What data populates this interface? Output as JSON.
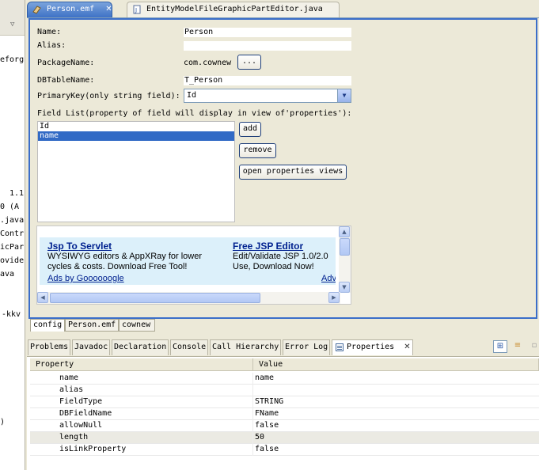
{
  "left_panel": {
    "fragments": [
      "eforg",
      "1.1",
      "0  (A",
      ".java",
      "Contr",
      "icPar",
      "ovide",
      "ava",
      "-kkv",
      ")"
    ]
  },
  "editor": {
    "tabs": [
      {
        "label": "Person.emf",
        "active": true,
        "icon": "emf-file-icon"
      },
      {
        "label": "EntityModelFileGraphicPartEditor.java",
        "active": false,
        "icon": "java-file-icon"
      }
    ],
    "form": {
      "name_label": "Name:",
      "name_value": "Person",
      "alias_label": "Alias:",
      "alias_value": "",
      "package_label": "PackageName:",
      "package_value": "com.cownew",
      "browse_label": "...",
      "table_label": "DBTableName:",
      "table_value": "T_Person",
      "pk_label": "PrimaryKey(only string field):",
      "pk_value": "Id",
      "fieldlist_label": "Field List(property of field will display in view of'properties'):",
      "fields": [
        "Id",
        "name"
      ],
      "selected_field": "name",
      "add_label": "add",
      "remove_label": "remove",
      "open_props_label": "open properties views"
    },
    "ad": {
      "title1": "Jsp To Servlet",
      "desc1a": "WYSIWYG editors & AppXRay for lower",
      "desc1b": "cycles & costs. Download Free Tool!",
      "title2": "Free JSP Editor",
      "desc2a": "Edit/Validate JSP 1.0/2.0",
      "desc2b": "Use, Download Now!",
      "ads_by": "Ads by Goooooogle",
      "adv": "Adv"
    },
    "bottom_tabs": [
      "config",
      "Person.emf",
      "cownew"
    ],
    "active_bottom_tab": "config"
  },
  "views": {
    "tabs": [
      "Problems",
      "Javadoc",
      "Declaration",
      "Console",
      "Call Hierarchy",
      "Error Log",
      "Properties"
    ],
    "active_tab": "Properties",
    "toolbar_icons": [
      "show-categories-icon",
      "show-advanced-icon",
      "restore-default-icon"
    ],
    "table": {
      "headers": [
        "Property",
        "Value"
      ],
      "rows": [
        {
          "name": "name",
          "value": "name"
        },
        {
          "name": "alias",
          "value": ""
        },
        {
          "name": "FieldType",
          "value": "STRING"
        },
        {
          "name": "DBFieldName",
          "value": "FName"
        },
        {
          "name": "allowNull",
          "value": "false"
        },
        {
          "name": "length",
          "value": "50"
        },
        {
          "name": "isLinkProperty",
          "value": "false"
        }
      ]
    }
  },
  "colors": {
    "active_tab": "#3e72c6",
    "frame_border": "#3b6ec9",
    "selection": "#316ac5",
    "ad_background": "#dcf0fa",
    "ad_link": "#00218f"
  }
}
